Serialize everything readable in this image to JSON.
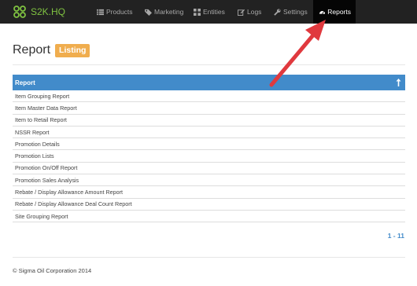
{
  "brand": {
    "name": "S2K.HQ",
    "color": "#7fc241"
  },
  "nav": {
    "products": "Products",
    "marketing": "Marketing",
    "entities": "Entities",
    "logs": "Logs",
    "settings": "Settings",
    "reports": "Reports",
    "active": "Reports"
  },
  "page": {
    "title": "Report",
    "badge": "Listing",
    "badge_color": "#f0ad4e"
  },
  "table": {
    "header": "Report",
    "header_color": "#428bca",
    "rows": [
      "Item Grouping Report",
      "Item Master Data Report",
      "Item to Retail Report",
      "NSSR Report",
      "Promotion Details",
      "Promotion Lists",
      "Promotion On/Off Report",
      "Promotion Sales Analysis",
      "Rebate / Display Allowance Amount Report",
      "Rebate / Display Allowance Deal Count Report",
      "Site Grouping Report"
    ]
  },
  "pager": "1 - 11",
  "footer": "© Sigma Oil Corporation 2014",
  "annotation_color": "#e0393e"
}
